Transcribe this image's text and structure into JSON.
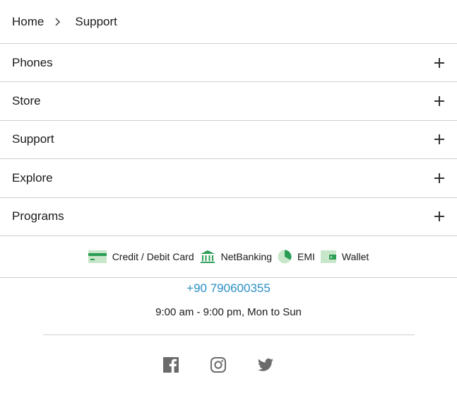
{
  "breadcrumb": {
    "home": "Home",
    "current": "Support"
  },
  "accordion": [
    {
      "label": "Phones"
    },
    {
      "label": "Store"
    },
    {
      "label": "Support"
    },
    {
      "label": "Explore"
    },
    {
      "label": "Programs"
    }
  ],
  "payments": [
    {
      "label": "Credit / Debit Card",
      "icon": "card-icon"
    },
    {
      "label": "NetBanking",
      "icon": "bank-icon"
    },
    {
      "label": "EMI",
      "icon": "emi-icon"
    },
    {
      "label": "Wallet",
      "icon": "wallet-icon"
    }
  ],
  "contact": {
    "phone": "+90 790600355",
    "hours": "9:00 am - 9:00 pm, Mon to Sun"
  },
  "social": [
    {
      "icon": "facebook-icon"
    },
    {
      "icon": "instagram-icon"
    },
    {
      "icon": "twitter-icon"
    }
  ],
  "colors": {
    "link": "#2a8fc4",
    "payment_green": "#2a9d55",
    "icon_grey": "#6b6b6b"
  }
}
